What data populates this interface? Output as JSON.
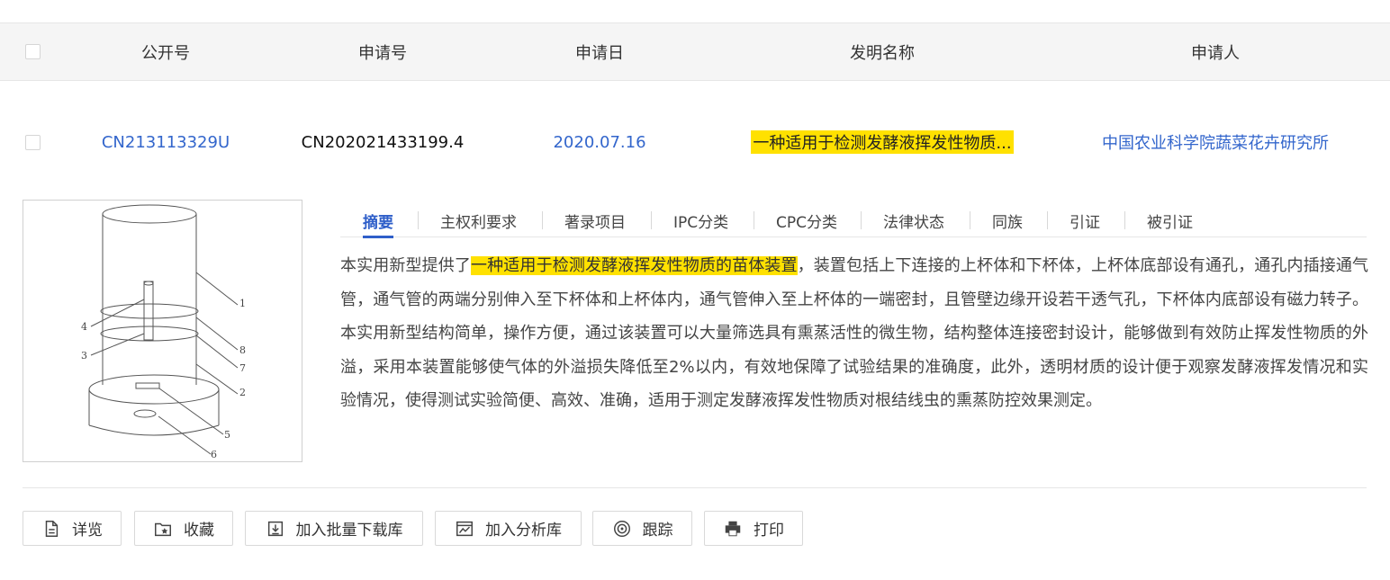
{
  "table": {
    "headers": {
      "pub_no": "公开号",
      "app_no": "申请号",
      "app_date": "申请日",
      "title": "发明名称",
      "applicant": "申请人"
    },
    "row": {
      "pub_no": "CN213113329U",
      "app_no": "CN202021433199.4",
      "app_date": "2020.07.16",
      "title": "一种适用于检测发酵液挥发性物质...",
      "applicant": "中国农业科学院蔬菜花卉研究所"
    }
  },
  "figure": {
    "labels": [
      "1",
      "2",
      "3",
      "4",
      "5",
      "6",
      "7",
      "8"
    ]
  },
  "tabs": [
    {
      "label": "摘要",
      "active": true
    },
    {
      "label": "主权利要求",
      "active": false
    },
    {
      "label": "著录项目",
      "active": false
    },
    {
      "label": "IPC分类",
      "active": false
    },
    {
      "label": "CPC分类",
      "active": false
    },
    {
      "label": "法律状态",
      "active": false
    },
    {
      "label": "同族",
      "active": false
    },
    {
      "label": "引证",
      "active": false
    },
    {
      "label": "被引证",
      "active": false
    }
  ],
  "abstract": {
    "prefix": "本实用新型提供了",
    "highlight": "一种适用于检测发酵液挥发性物质的苗体装置",
    "body": "，装置包括上下连接的上杯体和下杯体，上杯体底部设有通孔，通孔内插接通气管，通气管的两端分别伸入至下杯体和上杯体内，通气管伸入至上杯体的一端密封，且管壁边缘开设若干透气孔，下杯体内底部设有磁力转子。本实用新型结构简单，操作方便，通过该装置可以大量筛选具有熏蒸活性的微生物，结构整体连接密封设计，能够做到有效防止挥发性物质的外溢，采用本装置能够使气体的外溢损失降低至2%以内，有效地保障了试验结果的准确度，此外，透明材质的设计便于观察发酵液挥发情况和实验情况，使得测试实验简便、高效、准确，适用于测定发酵液挥发性物质对根结线虫的熏蒸防控效果测定。"
  },
  "actions": {
    "detail": "详览",
    "favorite": "收藏",
    "batch_download": "加入批量下载库",
    "analysis": "加入分析库",
    "track": "跟踪",
    "print": "打印"
  },
  "colors": {
    "link": "#3366cc",
    "highlight": "#ffe100",
    "active_tab": "#2f5fc9"
  }
}
